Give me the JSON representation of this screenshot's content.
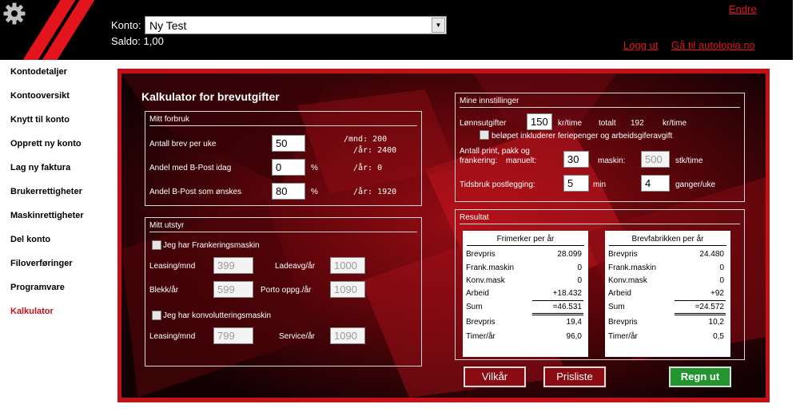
{
  "header": {
    "konto_label": "Konto:",
    "konto_selected": "Ny Test",
    "saldo_label": "Saldo:",
    "saldo_value": "1,00",
    "links": {
      "endre": "Endre",
      "logg_ut": "Logg ut",
      "autolopia": "Gå til autolopia.no"
    }
  },
  "sidebar": {
    "items": [
      {
        "label": "Kontodetaljer"
      },
      {
        "label": "Kontooversikt"
      },
      {
        "label": "Knytt til konto"
      },
      {
        "label": "Opprett ny konto"
      },
      {
        "label": "Lag ny faktura"
      },
      {
        "label": "Brukerrettigheter"
      },
      {
        "label": "Maskinrettigheter"
      },
      {
        "label": "Del konto"
      },
      {
        "label": "Filoverføringer"
      },
      {
        "label": "Programvare"
      },
      {
        "label": "Kalkulator",
        "active": true
      }
    ]
  },
  "calculator": {
    "title": "Kalkulator for brevutgifter",
    "forbruk": {
      "title": "Mitt forbruk",
      "brev_label": "Antall brev per uke",
      "brev_value": "50",
      "per_mnd": "/mnd: 200",
      "per_aar": "/år: 2400",
      "bpost_idag_label": "Andel med B-Post idag",
      "bpost_idag_value": "0",
      "bpost_idag_pct": "%",
      "bpost_idag_aar": "/år: 0",
      "bpost_onskes_label": "Andel B-Post som ønskes",
      "bpost_onskes_value": "80",
      "bpost_onskes_pct": "%",
      "bpost_onskes_aar": "/år: 1920"
    },
    "utstyr": {
      "title": "Mitt utstyr",
      "frank_check": "Jeg har Frankeringsmaskin",
      "leasing_label": "Leasing/mnd",
      "leasing_value": "399",
      "ladeavg_label": "Ladeavg/år",
      "ladeavg_value": "1000",
      "blekk_label": "Blekk/år",
      "blekk_value": "599",
      "porto_label": "Porto oppg./år",
      "porto_value": "1090",
      "konv_check": "Jeg har konvolutteringsmaskin",
      "konv_leasing_label": "Leasing/mnd",
      "konv_leasing_value": "799",
      "service_label": "Service/år",
      "service_value": "1090"
    },
    "innstillinger": {
      "title": "Mine innstillinger",
      "lonn_label": "Lønnsutgifter",
      "lonn_value": "150",
      "lonn_unit": "kr/time",
      "totalt_label": "totalt",
      "totalt_value": "192",
      "totalt_unit": "kr/time",
      "ferie_check": "beløpet inkluderer feriepenger og arbeidsgiferavgift",
      "print_label_1": "Antall print, pakk og",
      "print_label_2": "frankering:",
      "manuelt_label": "manuelt:",
      "manuelt_value": "30",
      "maskin_label": "maskin:",
      "maskin_value": "500",
      "stk_unit": "stk/time",
      "tidsbruk_label": "Tidsbruk postlegging:",
      "tidsbruk_value": "5",
      "min_unit": "min",
      "ganger_value": "4",
      "ganger_unit": "ganger/uke"
    },
    "resultat": {
      "title": "Resultat",
      "frimerker": {
        "title": "Frimerker per år",
        "rows": [
          {
            "label": "Brevpris",
            "value": "28.099"
          },
          {
            "label": "Frank.maskin",
            "value": "0"
          },
          {
            "label": "Konv.mask",
            "value": "0"
          },
          {
            "label": "Arbeid",
            "value": "+18.432"
          },
          {
            "label": "Sum",
            "value": "=46.531"
          },
          {
            "label": "Brevpris",
            "value": "19,4"
          },
          {
            "label": "Timer/år",
            "value": "96,0"
          }
        ]
      },
      "brevfabrikken": {
        "title": "Brevfabrikken per år",
        "rows": [
          {
            "label": "Brevpris",
            "value": "24.480"
          },
          {
            "label": "Frank.maskin",
            "value": "0"
          },
          {
            "label": "Konv.mask",
            "value": "0"
          },
          {
            "label": "Arbeid",
            "value": "+92"
          },
          {
            "label": "Sum",
            "value": "=24.572"
          },
          {
            "label": "Brevpris",
            "value": "10,2"
          },
          {
            "label": "Timer/år",
            "value": "0,5"
          }
        ]
      }
    },
    "buttons": {
      "vilkar": "Vilkår",
      "prisliste": "Prisliste",
      "regn_ut": "Regn ut"
    }
  }
}
